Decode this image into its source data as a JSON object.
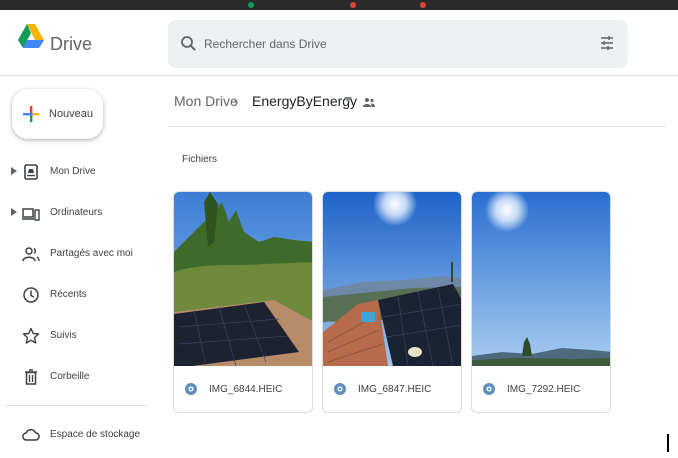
{
  "app": {
    "name": "Drive",
    "logo_icon": "google-drive-icon"
  },
  "colors": {
    "blue": "#4285f4",
    "green": "#0f9d58",
    "yellow": "#f4b400",
    "red": "#db4437",
    "heic_icon": "#5f8fbf"
  },
  "search": {
    "placeholder": "Rechercher dans Drive",
    "icon": "search-icon",
    "filter_icon": "tune-icon"
  },
  "new_button": {
    "label": "Nouveau",
    "icon": "plus-icon"
  },
  "sidebar": {
    "items": [
      {
        "label": "Mon Drive",
        "icon": "my-drive-icon",
        "expandable": true
      },
      {
        "label": "Ordinateurs",
        "icon": "computers-icon",
        "expandable": true
      },
      {
        "label": "Partagés avec moi",
        "icon": "shared-people-icon",
        "expandable": false
      },
      {
        "label": "Récents",
        "icon": "clock-icon",
        "expandable": false
      },
      {
        "label": "Suivis",
        "icon": "star-icon",
        "expandable": false
      },
      {
        "label": "Corbeille",
        "icon": "trash-icon",
        "expandable": false
      },
      {
        "label": "Espace de stockage",
        "icon": "cloud-icon",
        "expandable": false
      }
    ]
  },
  "breadcrumb": {
    "root": "Mon Drive",
    "separator": "›",
    "current": "EnergyByEnergy",
    "current_icon": "shared-folder-icon"
  },
  "main": {
    "section_title": "Fichiers",
    "files": [
      {
        "name": "IMG_6844.HEIC",
        "icon": "image-file-icon"
      },
      {
        "name": "IMG_6847.HEIC",
        "icon": "image-file-icon"
      },
      {
        "name": "IMG_7292.HEIC",
        "icon": "image-file-icon"
      }
    ]
  }
}
